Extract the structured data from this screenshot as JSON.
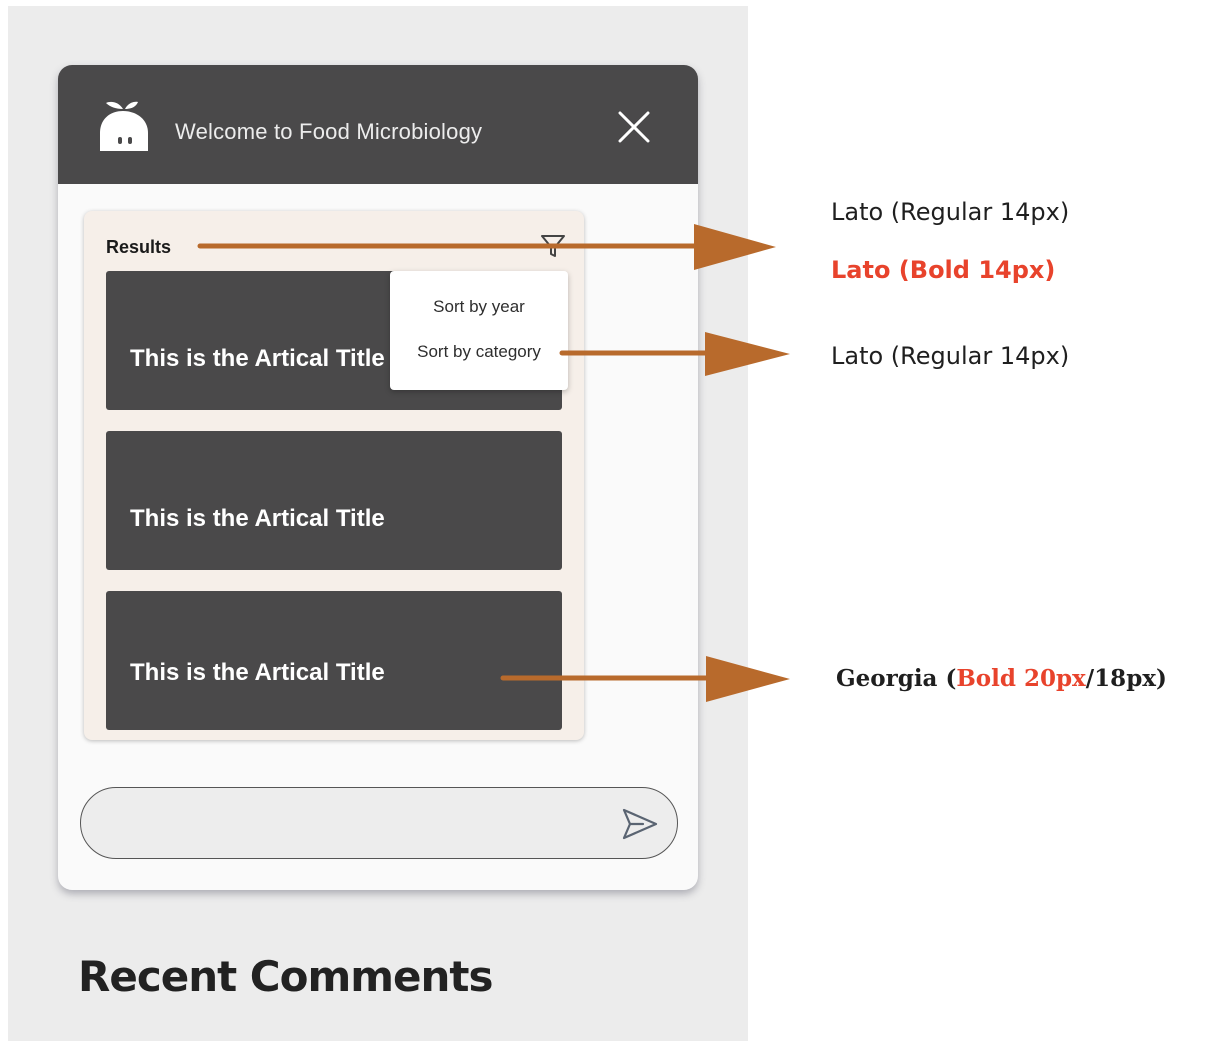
{
  "widget": {
    "header_title": "Welcome to Food Microbiology",
    "results_label": "Results",
    "articles": [
      {
        "title": "This is the Artical Title"
      },
      {
        "title": "This is the Artical Title"
      },
      {
        "title": "This is the Artical Title"
      }
    ],
    "sort_menu": {
      "items": [
        "Sort by year",
        "Sort by category"
      ]
    },
    "chat_input": {
      "value": "",
      "placeholder": ""
    }
  },
  "section_heading": "Recent Comments",
  "annotations": {
    "results_font_regular": "Lato (Regular 14px)",
    "results_font_bold": "Lato (Bold 14px)",
    "sort_font": "Lato (Regular 14px)",
    "title_font_prefix": "Georgia (",
    "title_font_highlight": "Bold 20px",
    "title_font_suffix": "/18px)"
  },
  "colors": {
    "header_bg": "#4a494a",
    "panel_bg": "#f6efe9",
    "card_bg": "#4a494a",
    "arrow": "#b86a2c",
    "highlight": "#e8432c"
  },
  "icons": {
    "logo": "food-mascot-icon",
    "close": "close-icon",
    "filter": "filter-icon",
    "send": "send-icon"
  }
}
